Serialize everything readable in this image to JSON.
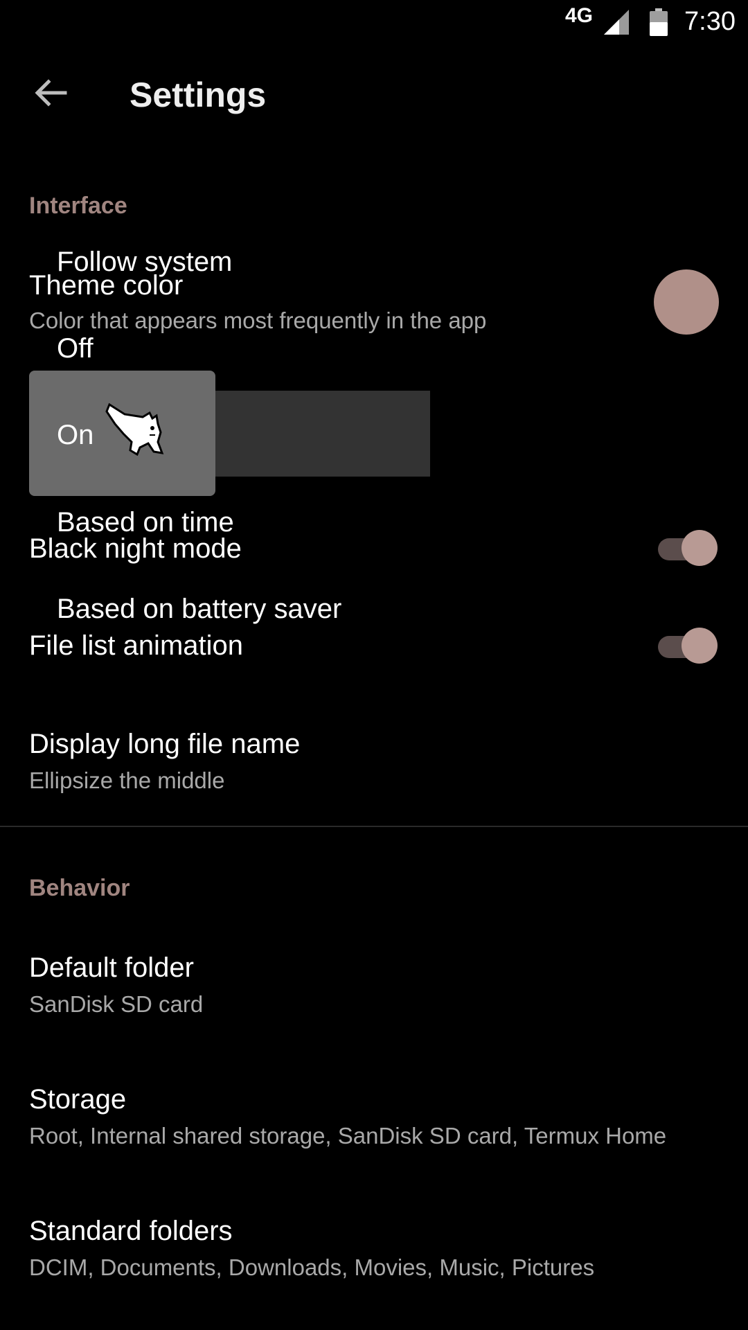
{
  "status_bar": {
    "network": "4G",
    "time": "7:30"
  },
  "toolbar": {
    "title": "Settings"
  },
  "sections": {
    "interface": {
      "header": "Interface",
      "theme_color": {
        "title": "Theme color",
        "summary": "Color that appears most frequently in the app",
        "swatch_color": "#b09089"
      },
      "black_night_mode": {
        "title": "Black night mode",
        "enabled": true
      },
      "file_list_animation": {
        "title": "File list animation",
        "enabled": true
      },
      "long_file_name": {
        "title": "Display long file name",
        "summary": "Ellipsize the middle"
      }
    },
    "behavior": {
      "header": "Behavior",
      "default_folder": {
        "title": "Default folder",
        "summary": "SanDisk SD card"
      },
      "storage": {
        "title": "Storage",
        "summary": "Root, Internal shared storage, SanDisk SD card, Termux Home"
      },
      "standard_folders": {
        "title": "Standard folders",
        "summary": "DCIM, Documents, Downloads, Movies, Music, Pictures"
      }
    }
  },
  "night_mode_menu": {
    "options": [
      "Follow system",
      "Off",
      "On",
      "Based on time",
      "Based on battery saver"
    ],
    "selected": "On"
  },
  "colors": {
    "accent": "#b09089",
    "section_header": "#a08580",
    "summary_text": "#a9a9a9",
    "background": "#000000"
  },
  "icons": {
    "back": "arrow-left-icon",
    "signal": "cell-signal-icon",
    "battery": "battery-icon",
    "cursor": "cat-cursor-icon"
  }
}
